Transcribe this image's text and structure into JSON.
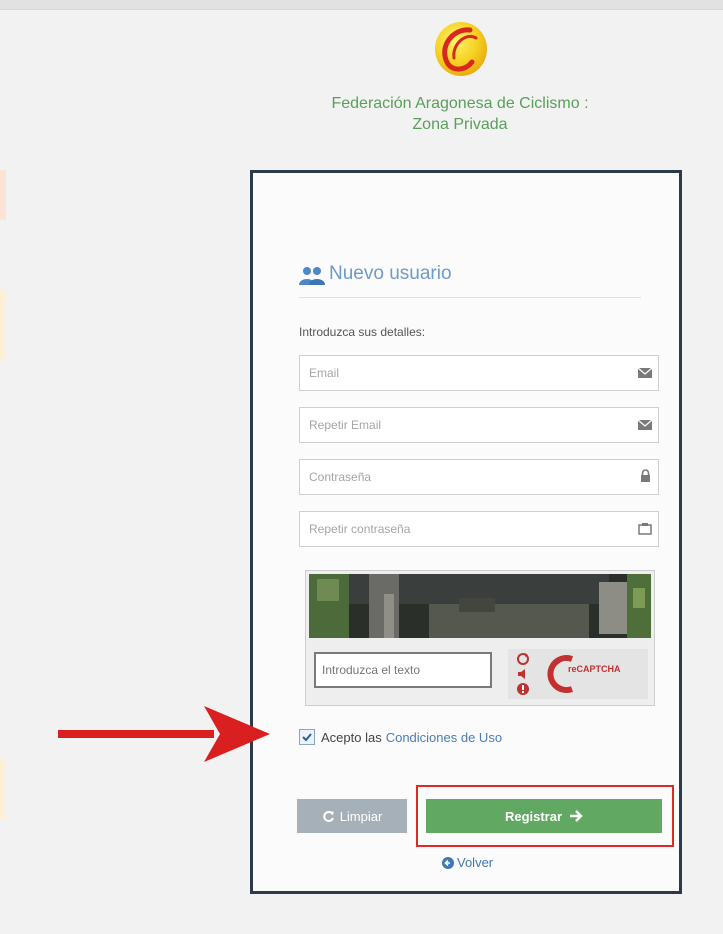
{
  "header": {
    "title_line1": "Federación Aragonesa de Ciclismo :",
    "title_line2": "Zona Privada"
  },
  "form": {
    "section_title": "Nuevo usuario",
    "intro": "Introduzca sus detalles:",
    "email": {
      "placeholder": "Email",
      "icon": "envelope-icon"
    },
    "repeat_email": {
      "placeholder": "Repetir Email",
      "icon": "envelope-icon"
    },
    "password": {
      "placeholder": "Contraseña",
      "icon": "lock-icon"
    },
    "repeat_password": {
      "placeholder": "Repetir contraseña",
      "icon": "retype-icon"
    },
    "captcha": {
      "placeholder": "Introduzca el texto",
      "brand": "reCAPTCHA"
    },
    "terms": {
      "checked": true,
      "label": "Acepto las",
      "link": "Condiciones de Uso"
    },
    "clear_label": "Limpiar",
    "register_label": "Registrar",
    "back_label": "Volver"
  },
  "colors": {
    "title_green": "#5b9e5b",
    "panel_border": "#2e3a4c",
    "register_green": "#61a963",
    "clear_gray": "#a6b0b8",
    "link_blue": "#4a7fb5",
    "highlight_red": "#e02828"
  }
}
